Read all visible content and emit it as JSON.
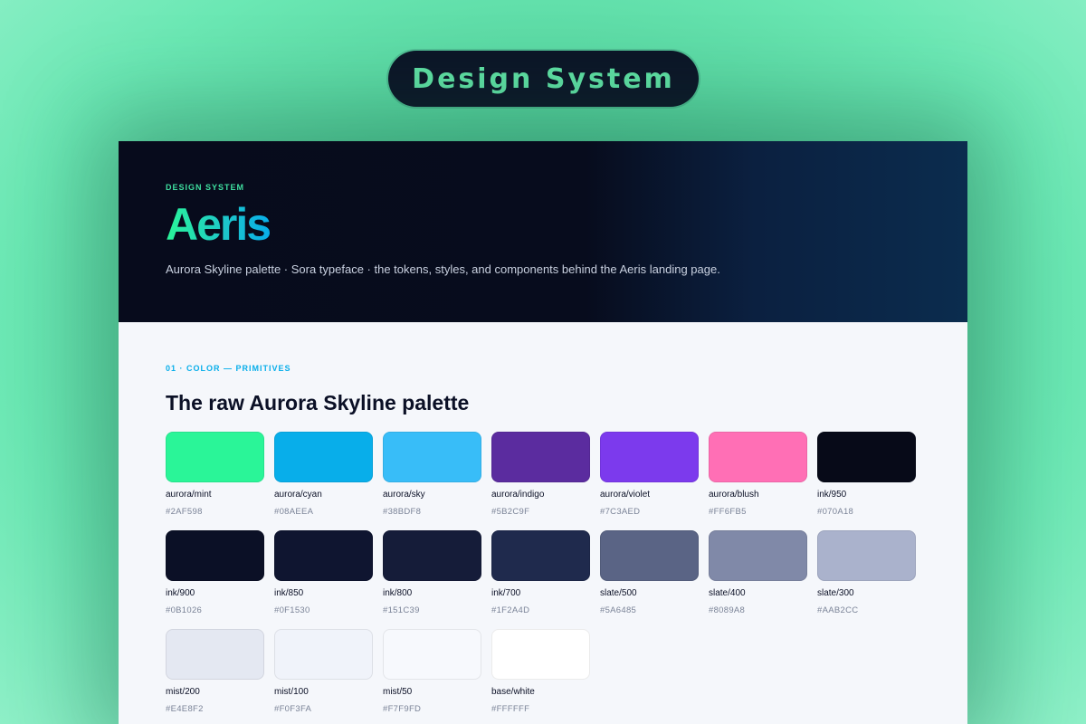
{
  "badge": {
    "label": "Design System"
  },
  "hero": {
    "eyebrow": "DESIGN SYSTEM",
    "brand": "Aeris",
    "tagline": "Aurora Skyline palette · Sora typeface · the tokens, styles, and components behind the Aeris landing page."
  },
  "section": {
    "label": "01 · COLOR — PRIMITIVES",
    "title": "The raw Aurora Skyline palette"
  },
  "swatches": [
    {
      "name": "aurora/mint",
      "hex": "#2AF598",
      "color": "#2AF598"
    },
    {
      "name": "aurora/cyan",
      "hex": "#08AEEA",
      "color": "#08AEEA"
    },
    {
      "name": "aurora/sky",
      "hex": "#38BDF8",
      "color": "#38BDF8"
    },
    {
      "name": "aurora/indigo",
      "hex": "#5B2C9F",
      "color": "#5B2C9F"
    },
    {
      "name": "aurora/violet",
      "hex": "#7C3AED",
      "color": "#7C3AED"
    },
    {
      "name": "aurora/blush",
      "hex": "#FF6FB5",
      "color": "#FF6FB5"
    },
    {
      "name": "ink/950",
      "hex": "#070A18",
      "color": "#070A18"
    },
    {
      "name": "ink/900",
      "hex": "#0B1026",
      "color": "#0B1026"
    },
    {
      "name": "ink/850",
      "hex": "#0F1530",
      "color": "#0F1530"
    },
    {
      "name": "ink/800",
      "hex": "#151C39",
      "color": "#151C39"
    },
    {
      "name": "ink/700",
      "hex": "#1F2A4D",
      "color": "#1F2A4D"
    },
    {
      "name": "slate/500",
      "hex": "#5A6485",
      "color": "#5A6485"
    },
    {
      "name": "slate/400",
      "hex": "#8089A8",
      "color": "#8089A8"
    },
    {
      "name": "slate/300",
      "hex": "#AAB2CC",
      "color": "#AAB2CC"
    },
    {
      "name": "mist/200",
      "hex": "#E4E8F2",
      "color": "#E4E8F2"
    },
    {
      "name": "mist/100",
      "hex": "#F0F3FA",
      "color": "#F0F3FA"
    },
    {
      "name": "mist/50",
      "hex": "#F7F9FD",
      "color": "#F7F9FD"
    },
    {
      "name": "base/white",
      "hex": "#FFFFFF",
      "color": "#FFFFFF"
    }
  ]
}
